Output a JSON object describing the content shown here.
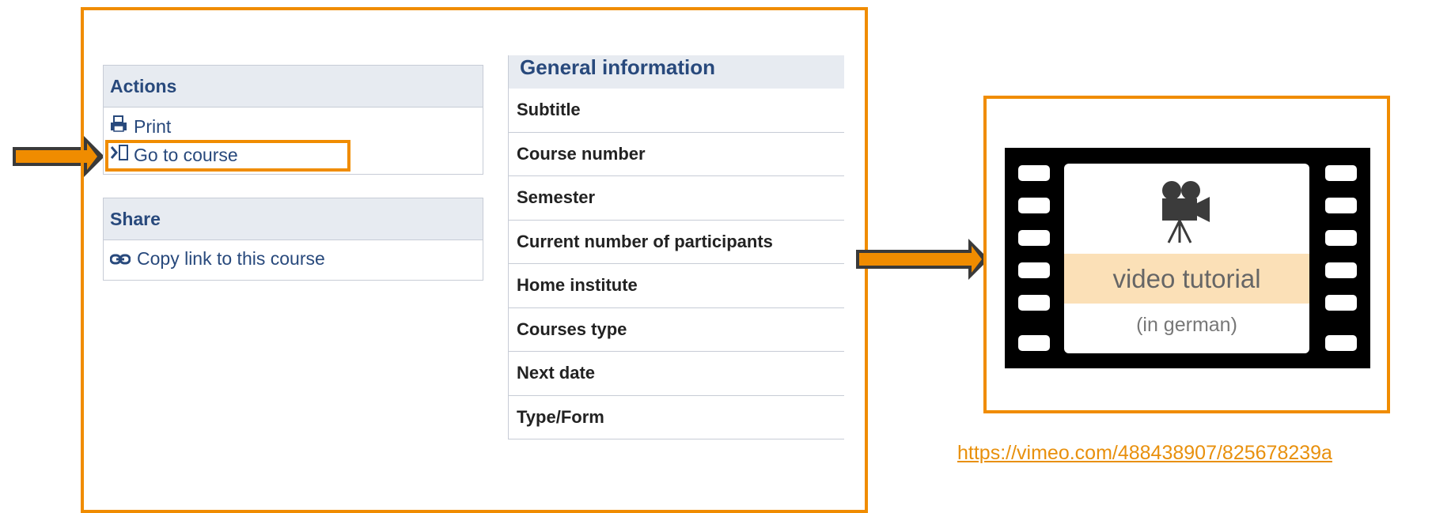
{
  "actions": {
    "title": "Actions",
    "items": [
      {
        "label": "Print",
        "icon": "printer-icon"
      },
      {
        "label": "Go to course",
        "icon": "go-to-course-icon"
      }
    ]
  },
  "share": {
    "title": "Share",
    "items": [
      {
        "label": "Copy link to this course",
        "icon": "link-icon"
      }
    ]
  },
  "general_information": {
    "title": "General information",
    "rows": [
      "Subtitle",
      "Course number",
      "Semester",
      "Current number of participants",
      "Home institute",
      "Courses type",
      "Next date",
      "Type/Form"
    ]
  },
  "video": {
    "label": "video tutorial",
    "sublabel": "(in german)",
    "icon": "video-camera-icon"
  },
  "link": "https://vimeo.com/488438907/825678239a",
  "colors": {
    "accent_orange": "#f08c00",
    "header_bg": "#e7ebf1",
    "header_text": "#28497c",
    "arrow_dark": "#3a3a3a"
  }
}
